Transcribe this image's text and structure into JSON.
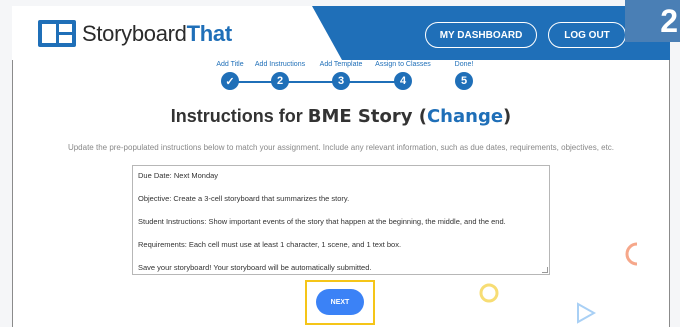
{
  "header": {
    "logo_prefix": "Storyboard",
    "logo_suffix": "That",
    "dashboard_label": "MY DASHBOARD",
    "logout_label": "LOG OUT",
    "step_badge": "2"
  },
  "progress": {
    "steps": [
      {
        "label": "Add Title",
        "marker": "✓"
      },
      {
        "label": "Add Instructions",
        "marker": "2"
      },
      {
        "label": "Add Template",
        "marker": "3"
      },
      {
        "label": "Assign to Classes",
        "marker": "4"
      },
      {
        "label": "Done!",
        "marker": "5"
      }
    ]
  },
  "page": {
    "title_prefix": "Instructions for ",
    "story_name": "BME Story",
    "change_open": " (",
    "change_label": "Change",
    "change_close": ")",
    "instructions": "Update the pre-populated instructions below to match your assignment. Include any relevant information, such as due dates, requirements, objectives, etc."
  },
  "textarea": {
    "lines": [
      "Due Date: Next Monday",
      "Objective: Create a 3-cell storyboard that summarizes the story.",
      "Student Instructions: Show important events of the story that happen at the beginning, the middle, and the end.",
      "Requirements: Each cell must use at least 1 character, 1 scene, and 1 text box.",
      "Save your storyboard! Your storyboard will be automatically submitted."
    ]
  },
  "next_label": "NEXT",
  "colors": {
    "brand": "#1f6fb8",
    "next": "#3b82f6",
    "highlight": "#f5c518"
  }
}
